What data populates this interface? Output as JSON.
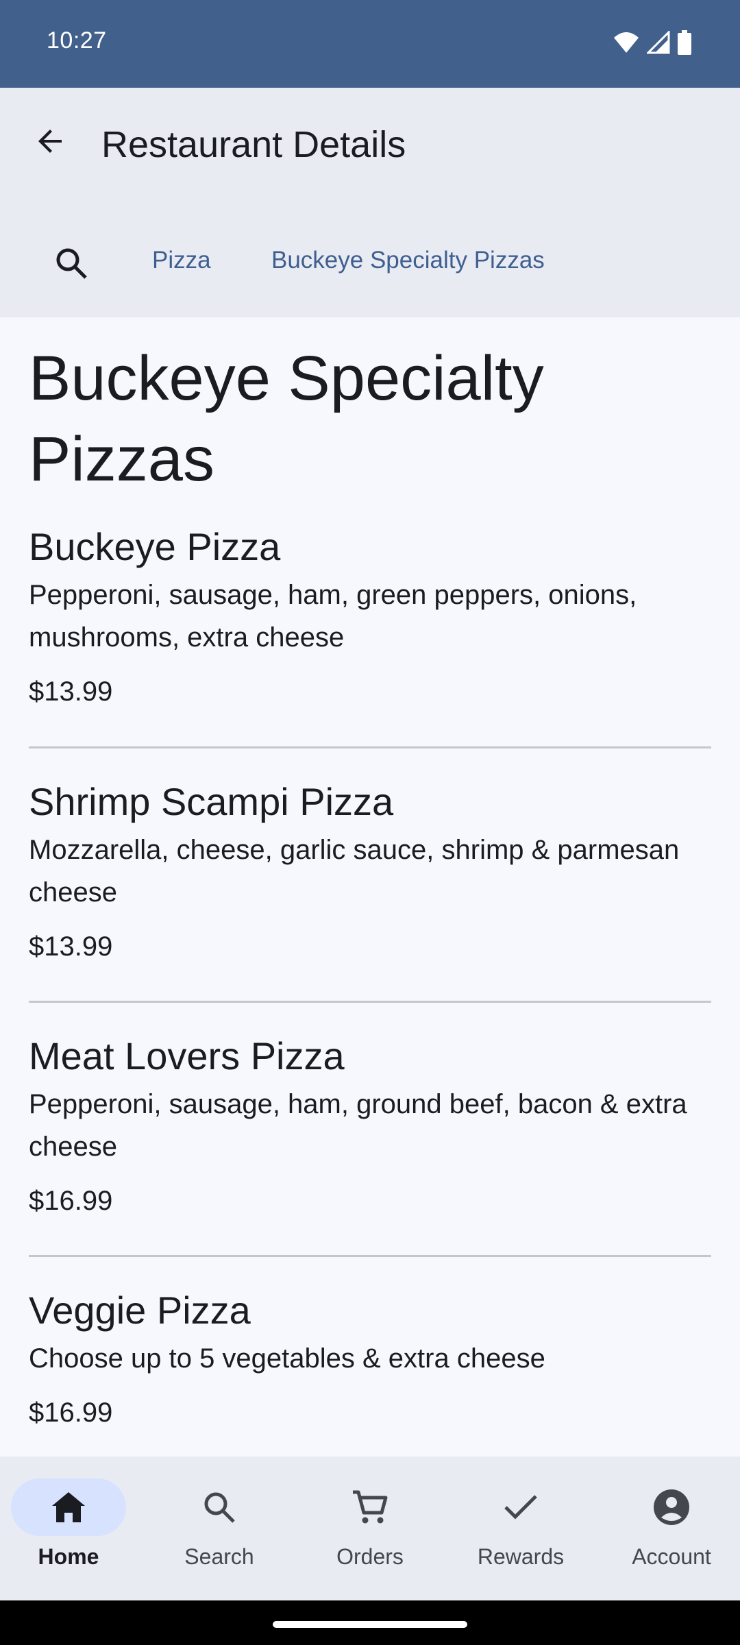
{
  "status_bar": {
    "time": "10:27"
  },
  "app_bar": {
    "title": "Restaurant Details"
  },
  "breadcrumbs": [
    "Pizza",
    "Buckeye Specialty Pizzas"
  ],
  "page": {
    "heading": "Buckeye Specialty Pizzas"
  },
  "menu_items": [
    {
      "name": "Buckeye Pizza",
      "description": "Pepperoni, sausage, ham, green peppers, onions, mushrooms, extra cheese",
      "price": "$13.99"
    },
    {
      "name": "Shrimp Scampi Pizza",
      "description": "Mozzarella, cheese, garlic sauce, shrimp & parmesan cheese",
      "price": "$13.99"
    },
    {
      "name": "Meat Lovers Pizza",
      "description": "Pepperoni, sausage, ham, ground beef, bacon & extra cheese",
      "price": "$16.99"
    },
    {
      "name": "Veggie Pizza",
      "description": "Choose up to 5 vegetables & extra cheese",
      "price": "$16.99"
    }
  ],
  "bottom_nav": [
    {
      "label": "Home",
      "icon": "home-icon",
      "active": true
    },
    {
      "label": "Search",
      "icon": "search-icon",
      "active": false
    },
    {
      "label": "Orders",
      "icon": "cart-icon",
      "active": false
    },
    {
      "label": "Rewards",
      "icon": "check-icon",
      "active": false
    },
    {
      "label": "Account",
      "icon": "account-icon",
      "active": false
    }
  ],
  "colors": {
    "status_bar": "#42608c",
    "app_bar": "#e9ebf3",
    "accent_text": "#3f5f90",
    "active_nav_pill": "#d7e2ff",
    "background": "#f7f8fd"
  }
}
